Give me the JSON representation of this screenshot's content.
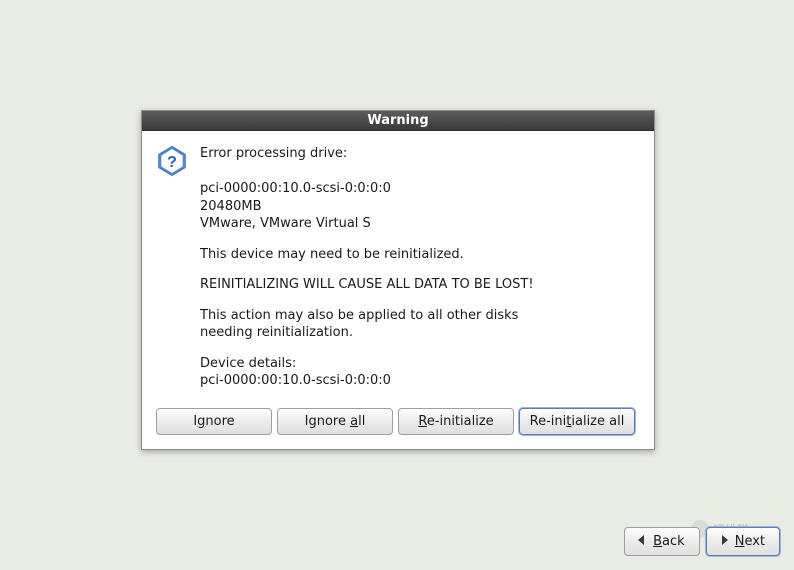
{
  "dialog": {
    "title": "Warning",
    "msg_error": "Error processing drive:",
    "msg_drive_path": "pci-0000:00:10.0-scsi-0:0:0:0",
    "msg_drive_size": "20480MB",
    "msg_drive_vendor": "VMware, VMware Virtual S",
    "msg_reinit_needed": "This device may need to be reinitialized.",
    "msg_warn": "REINITIALIZING WILL CAUSE ALL DATA TO BE LOST!",
    "msg_apply_all_1": "This action may also be applied to all other disks",
    "msg_apply_all_2": "needing reinitialization.",
    "msg_details_label": "Device details:",
    "msg_details_value": "pci-0000:00:10.0-scsi-0:0:0:0"
  },
  "buttons": {
    "ignore_pre": "I",
    "ignore_mn": "g",
    "ignore_post": "nore",
    "ignore_all_pre": "Ignore ",
    "ignore_all_mn": "a",
    "ignore_all_post": "ll",
    "reinit_pre": "",
    "reinit_mn": "R",
    "reinit_post": "e-initialize",
    "reinit_all_pre": "Re-ini",
    "reinit_all_mn": "t",
    "reinit_all_post": "ialize all"
  },
  "nav": {
    "back_mn": "B",
    "back_post": "ack",
    "next_mn": "N",
    "next_post": "ext"
  },
  "watermark": {
    "text": "运维猫"
  }
}
